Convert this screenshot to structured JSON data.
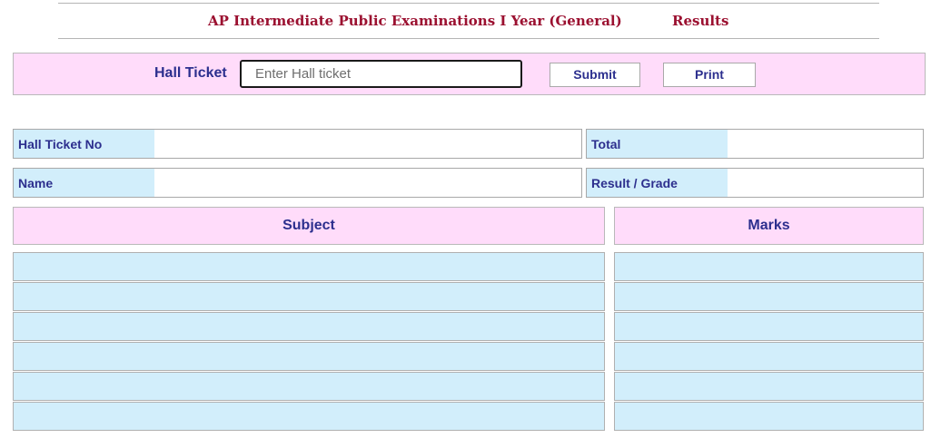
{
  "header": {
    "title": "AP Intermediate Public Examinations I Year (General)",
    "results_label": "Results"
  },
  "search": {
    "hall_ticket_label": "Hall Ticket",
    "placeholder": "Enter Hall ticket",
    "value": "",
    "submit_label": "Submit",
    "print_label": "Print"
  },
  "info": {
    "hall_ticket_no_label": "Hall Ticket No",
    "hall_ticket_no_value": "",
    "total_label": "Total",
    "total_value": "",
    "name_label": "Name",
    "name_value": "",
    "result_grade_label": "Result / Grade",
    "result_grade_value": ""
  },
  "table": {
    "subject_header": "Subject",
    "marks_header": "Marks",
    "rows": [
      {
        "subject": "",
        "marks": ""
      },
      {
        "subject": "",
        "marks": ""
      },
      {
        "subject": "",
        "marks": ""
      },
      {
        "subject": "",
        "marks": ""
      },
      {
        "subject": "",
        "marks": ""
      },
      {
        "subject": "",
        "marks": ""
      }
    ]
  },
  "colors": {
    "title": "#9b1030",
    "label_text": "#2c2f8e",
    "pink_panel": "#ffdcfa",
    "blue_cell": "#d2eefb"
  }
}
